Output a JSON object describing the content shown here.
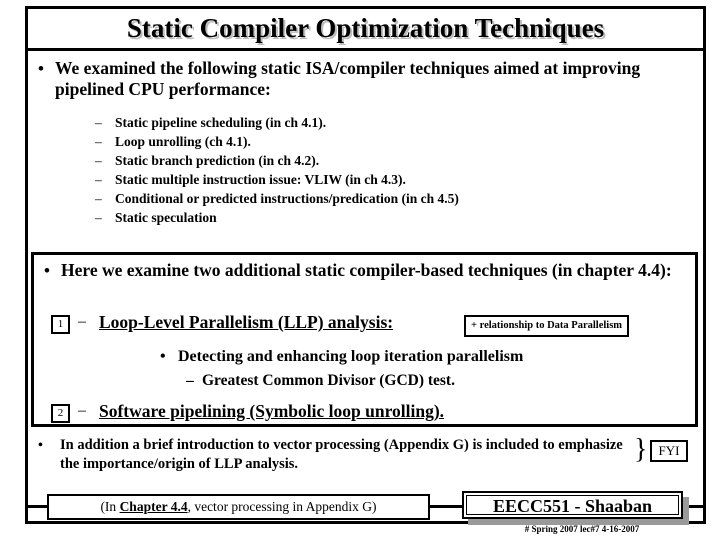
{
  "slide": {
    "title": "Static Compiler Optimization Techniques",
    "bullet_marker": "•",
    "dash_marker": "–",
    "intro_bullet": "We examined the following static ISA/compiler techniques aimed at improving pipelined CPU performance:",
    "techniques": [
      "Static pipeline scheduling (in ch 4.1).",
      "Loop unrolling (ch 4.1).",
      "Static branch prediction (in ch 4.2).",
      "Static multiple instruction issue:  VLIW (in ch 4.3).",
      "Conditional or predicted instructions/predication (in ch 4.5)",
      "Static speculation"
    ],
    "mid_bullet": "Here we examine two additional static compiler-based techniques (in chapter 4.4):",
    "item_one_number": "1",
    "item_one_title": "Loop-Level Parallelism (LLP) analysis:",
    "callout_note": "+ relationship to Data Parallelism",
    "detect_bullet": "•",
    "detect_text": "Detecting and enhancing loop iteration parallelism",
    "gcd_dash": "–",
    "gcd_text": "Greatest Common Divisor (GCD) test.",
    "item_two_number": "2",
    "item_two_title": "Software pipelining (Symbolic loop unrolling).",
    "vector_bullet": "In addition a brief introduction to vector processing (Appendix G) is included to emphasize the importance/origin of LLP analysis.",
    "brace_glyph": "}",
    "fyi_label": "FYI"
  },
  "footer": {
    "left_prefix": "(In ",
    "left_link": "Chapter 4.4",
    "left_suffix": ", vector processing in Appendix G)",
    "course": "EECC551 - Shaaban",
    "note": "#  Spring 2007  lec#7   4-16-2007"
  }
}
